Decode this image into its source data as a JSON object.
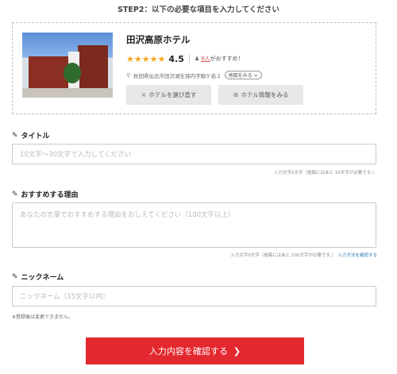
{
  "step_title": "STEP2：以下の必要な項目を入力してください",
  "hotel": {
    "name": "田沢高原ホテル",
    "score": "4.5",
    "recommend_count": "9人",
    "recommend_suffix": "がおすすめ！",
    "address": "秋田県仙北市田沢湖生保内字駒ケ岳２",
    "map_link": "地図をみる",
    "reselect_button": "ホテルを選び直す",
    "info_button": "ホテル情報をみる",
    "stars": 5
  },
  "title_field": {
    "label": "タイトル",
    "placeholder": "10文字〜30文字で入力してください",
    "hint": "入力文字0文字（投稿にはあと 10文字が必要です。）"
  },
  "reason_field": {
    "label": "おすすめする理由",
    "placeholder": "あなたの言葉でおすすめする理由をおしえてください（100文字以上）",
    "hint": "入力文字0文字（投稿にはあと 100文字が必要です。）",
    "how_link": "入力方法を確認する"
  },
  "nickname_field": {
    "label": "ニックネーム",
    "placeholder": "ニックネーム（15文字以内）",
    "note": "※登録後は変更できません。"
  },
  "confirm_button": "入力内容を確認する",
  "colors": {
    "accent": "#e4282f",
    "star": "#f2a71b",
    "link": "#2b7fb8"
  }
}
